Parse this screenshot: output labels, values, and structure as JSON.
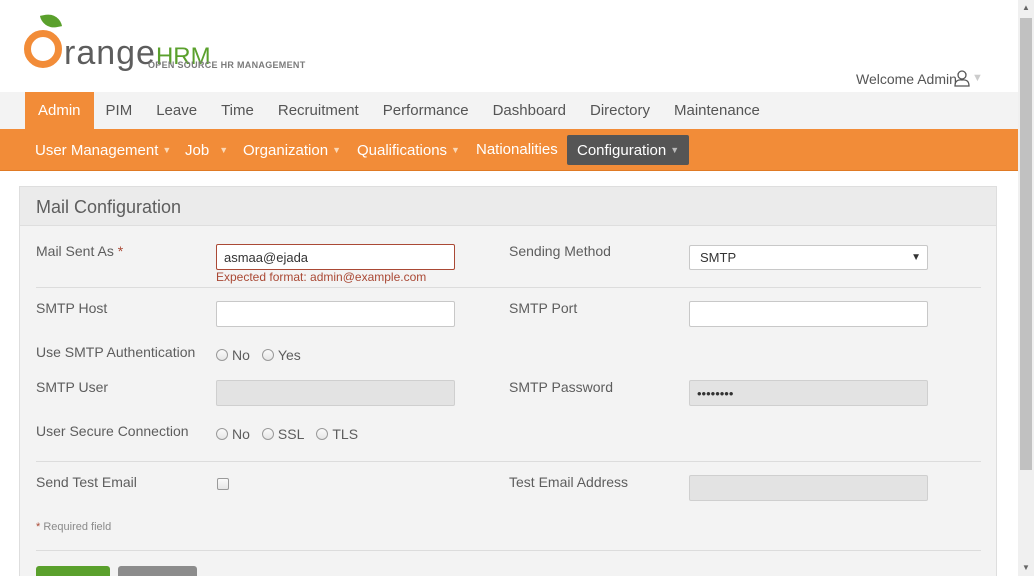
{
  "header": {
    "logo_main": "range",
    "logo_hrm": "HRM",
    "logo_subtitle": "OPEN SOURCE HR MANAGEMENT",
    "welcome_text": "Welcome Admin"
  },
  "topnav": [
    "Admin",
    "PIM",
    "Leave",
    "Time",
    "Recruitment",
    "Performance",
    "Dashboard",
    "Directory",
    "Maintenance"
  ],
  "subnav": [
    "User Management",
    "Job",
    "Organization",
    "Qualifications",
    "Nationalities",
    "Configuration"
  ],
  "panel": {
    "title": "Mail Configuration",
    "mail_sent_as_label": "Mail Sent As",
    "required_star": "*",
    "mail_sent_as_value": "asmaa@ejada",
    "mail_sent_as_error": "Expected format: admin@example.com",
    "sending_method_label": "Sending Method",
    "sending_method_value": "SMTP",
    "smtp_host_label": "SMTP Host",
    "smtp_port_label": "SMTP Port",
    "smtp_auth_label": "Use SMTP Authentication",
    "smtp_auth_options": [
      "No",
      "Yes"
    ],
    "smtp_user_label": "SMTP User",
    "smtp_password_label": "SMTP Password",
    "smtp_password_value": "••••••••",
    "secure_conn_label": "User Secure Connection",
    "secure_conn_options": [
      "No",
      "SSL",
      "TLS"
    ],
    "send_test_label": "Send Test Email",
    "test_address_label": "Test Email Address",
    "required_note": "Required field"
  },
  "colors": {
    "brand_orange": "#f28c38",
    "brand_green": "#5aa02c",
    "active_sub": "#555555",
    "error": "#aa4935"
  }
}
